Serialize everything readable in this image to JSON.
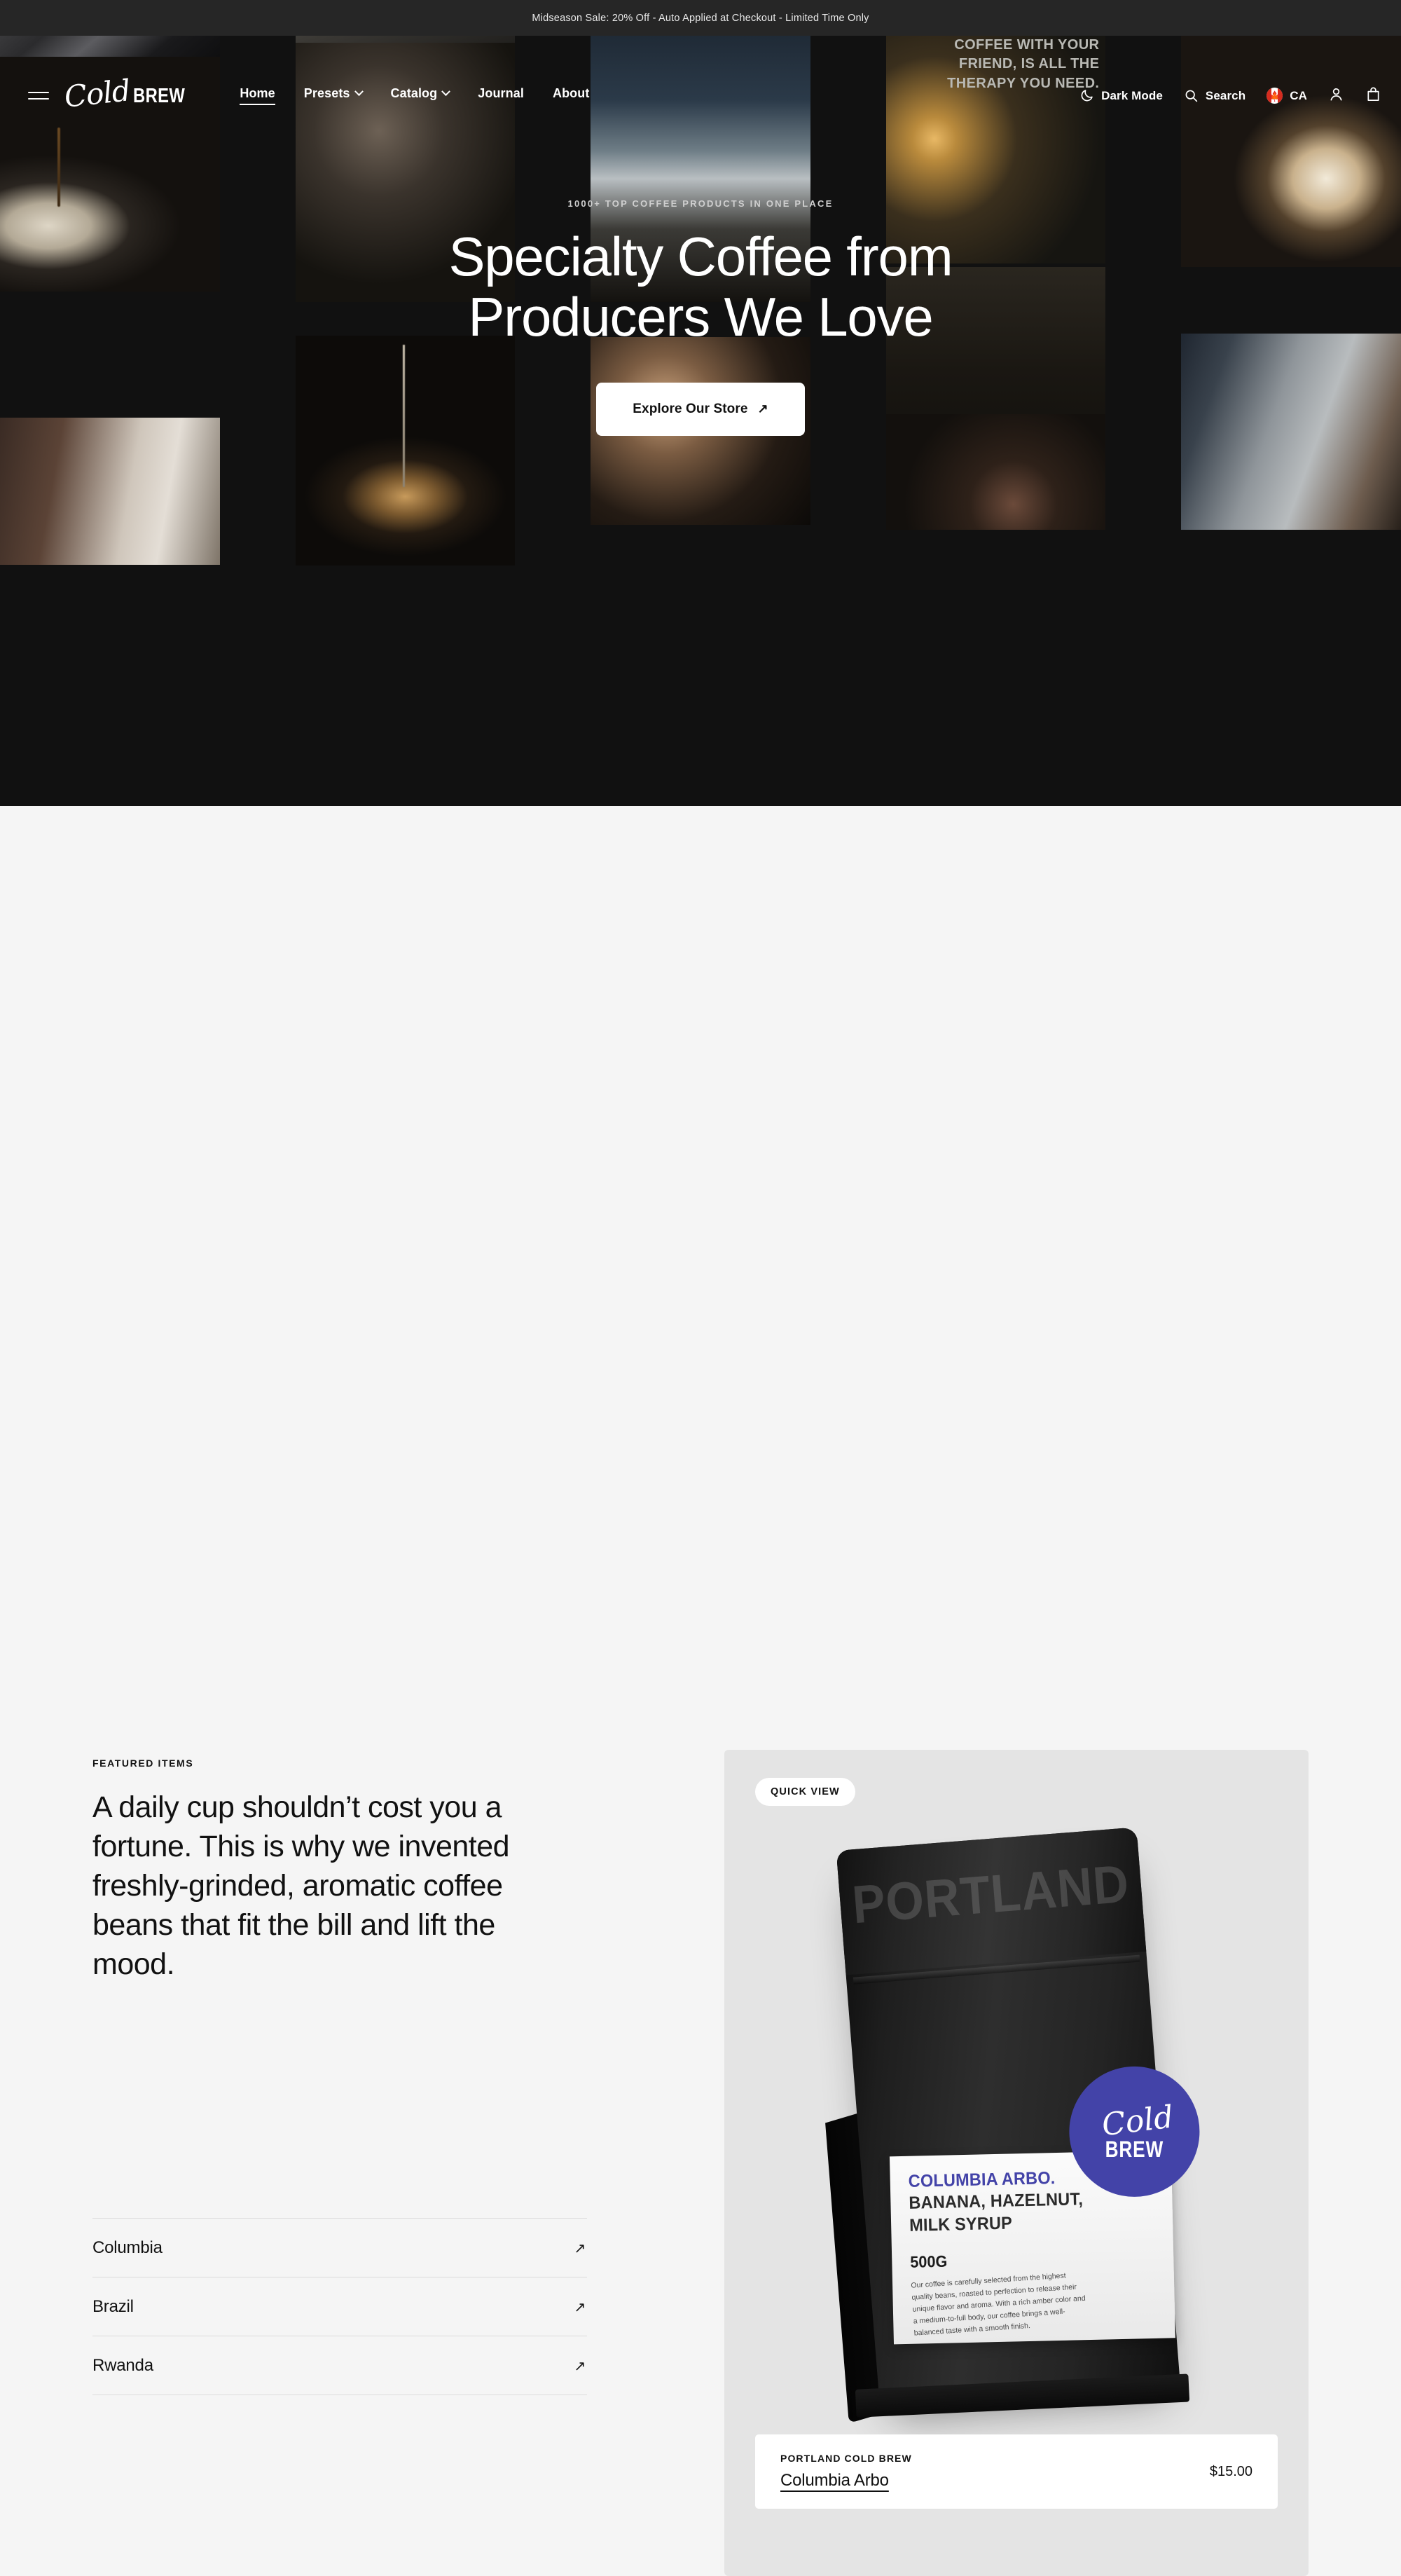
{
  "announcement": {
    "text": "Midseason Sale: 20% Off - Auto Applied at Checkout - Limited Time Only"
  },
  "header": {
    "menu_icon": "hamburger-icon",
    "logo": {
      "script": "Cold",
      "block": "BREW"
    },
    "nav": [
      {
        "label": "Home",
        "has_chevron": false,
        "active": true
      },
      {
        "label": "Presets",
        "has_chevron": true,
        "active": false
      },
      {
        "label": "Catalog",
        "has_chevron": true,
        "active": false
      },
      {
        "label": "Journal",
        "has_chevron": false,
        "active": false
      },
      {
        "label": "About",
        "has_chevron": false,
        "active": false
      }
    ],
    "dark_mode_label": "Dark Mode",
    "search_label": "Search",
    "country_label": "CA",
    "account_icon": "user-icon",
    "cart_icon": "shopping-bag-icon"
  },
  "hero": {
    "eyebrow": "1000+ TOP COFFEE PRODUCTS IN ONE PLACE",
    "title_line1": "Specialty Coffee from",
    "title_line2": "Producers We Love",
    "cta_label": "Explore Our Store",
    "cta_arrow": "↗",
    "poster_text": "SOMETIMES, HAVING COFFEE WITH YOUR FRIEND, IS ALL THE THERAPY YOU NEED.",
    "background": "#111111"
  },
  "featured": {
    "kicker": "FEATURED ITEMS",
    "lede": "A daily cup shouldn’t cost you a fortune. This is why we invented freshly-grinded, aromatic coffee beans that fit the bill and lift the mood.",
    "origins": [
      {
        "label": "Columbia",
        "arrow": "↗"
      },
      {
        "label": "Brazil",
        "arrow": "↗"
      },
      {
        "label": "Rwanda",
        "arrow": "↗"
      }
    ]
  },
  "product_card": {
    "quick_view_label": "QUICK VIEW",
    "bag_wordmark": "PORTLAND",
    "badge": {
      "script": "Cold",
      "block": "BREW",
      "color": "#4343a8"
    },
    "label": {
      "title": "COLUMBIA ARBO.",
      "notes_line1": "BANANA, HAZELNUT,",
      "notes_line2": "MILK SYRUP",
      "weight": "500G",
      "description": "Our coffee is carefully selected from the highest quality beans, roasted to perfection to release their unique flavor and aroma. With a rich amber color and a medium-to-full body, our coffee brings a well-balanced taste with a smooth finish."
    },
    "brand": "PORTLAND COLD BREW",
    "name": "Columbia Arbo",
    "price": "$15.00"
  },
  "theme": {
    "page_bg": "#f5f5f5",
    "dark_bg": "#111111",
    "announce_bg": "#262626",
    "card_bg": "#e4e4e4",
    "accent": "#4343a8"
  }
}
